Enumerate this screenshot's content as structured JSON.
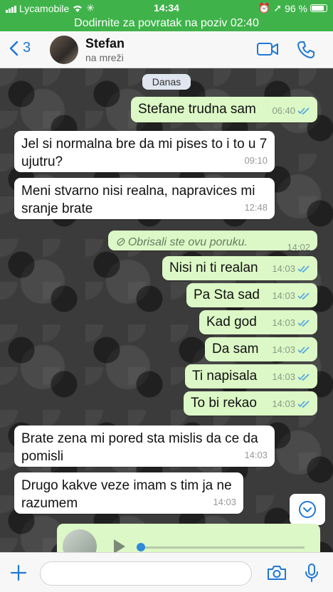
{
  "status_bar": {
    "carrier": "Lycamobile",
    "time": "14:34",
    "battery": "96 %"
  },
  "call_banner": "Dodirnite za povratak na poziv 02:40",
  "header": {
    "back_count": "3",
    "contact_name": "Stefan",
    "contact_status": "na mreži"
  },
  "date_divider": "Danas",
  "messages": [
    {
      "direction": "out",
      "text": "Stefane trudna sam",
      "time": "06:40",
      "read": true
    },
    {
      "direction": "in",
      "text": "Jel si normalna bre da mi pises to i to u 7 ujutru?",
      "time": "09:10"
    },
    {
      "direction": "in",
      "text": "Meni stvarno nisi realna, napravices mi sranje brate",
      "time": "12:48"
    },
    {
      "direction": "out",
      "text": "Obrisali ste ovu poruku.",
      "time": "14:02",
      "deleted": true
    },
    {
      "direction": "out",
      "text": "Nisi ni ti realan",
      "time": "14:03",
      "read": true
    },
    {
      "direction": "out",
      "text": "Pa Sta sad",
      "time": "14:03",
      "read": true
    },
    {
      "direction": "out",
      "text": "Kad god",
      "time": "14:03",
      "read": true
    },
    {
      "direction": "out",
      "text": "Da sam",
      "time": "14:03",
      "read": true
    },
    {
      "direction": "out",
      "text": "Ti napisala",
      "time": "14:03",
      "read": true
    },
    {
      "direction": "out",
      "text": "To bi rekao",
      "time": "14:03",
      "read": true
    },
    {
      "direction": "in",
      "text": "Brate zena mi pored sta mislis da ce da pomisli",
      "time": "14:03"
    },
    {
      "direction": "in",
      "text": "Drugo kakve veze imam s tim ja ne razumem",
      "time": "14:03"
    }
  ],
  "colors": {
    "status_green": "#3fb34a",
    "accent_blue": "#1e78d6",
    "outgoing_bubble": "#dcf8c6",
    "incoming_bubble": "#ffffff",
    "read_ticks": "#4fa3e0"
  },
  "icons": {
    "back": "chevron-left-icon",
    "video": "video-camera-icon",
    "call": "phone-icon",
    "scroll_down": "chevron-down-circle-icon",
    "attach": "plus-icon",
    "camera": "camera-icon",
    "mic": "microphone-icon"
  }
}
